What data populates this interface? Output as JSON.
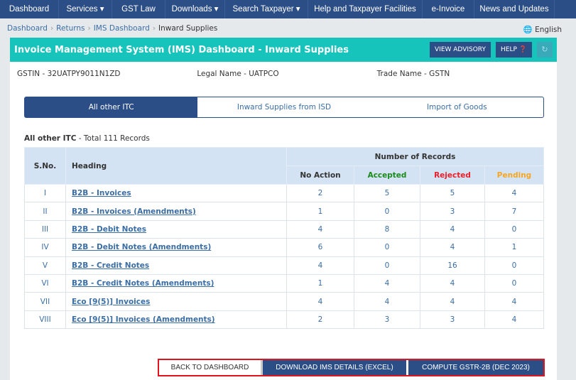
{
  "nav": [
    "Dashboard",
    "Services ▾",
    "GST Law",
    "Downloads ▾",
    "Search Taxpayer ▾",
    "Help and Taxpayer Facilities",
    "e-Invoice",
    "News and Updates"
  ],
  "breadcrumb": [
    "Dashboard",
    "Returns",
    "IMS Dashboard",
    "Inward Supplies"
  ],
  "language": "English",
  "header": {
    "title": "Invoice Management System (IMS) Dashboard - Inward Supplies",
    "advisory": "VIEW ADVISORY",
    "help": "HELP"
  },
  "info": {
    "gstin": "GSTIN - 32UATPY9011N1ZD",
    "legal": "Legal Name - UATPCO",
    "trade": "Trade Name - GSTN"
  },
  "tabs": [
    "All other ITC",
    "Inward Supplies from ISD",
    "Import of Goods"
  ],
  "section": {
    "title": "All other ITC",
    "total": " - Total 111 Records"
  },
  "table": {
    "headers": {
      "sno": "S.No.",
      "heading": "Heading",
      "group": "Number of Records",
      "no_action": "No Action",
      "accepted": "Accepted",
      "rejected": "Rejected",
      "pending": "Pending"
    },
    "colors": {
      "accepted": "#1a8a1a",
      "rejected": "#e8202a",
      "pending": "#f5a623"
    },
    "rows": [
      [
        "I",
        "B2B - Invoices",
        "2",
        "5",
        "5",
        "4"
      ],
      [
        "II",
        "B2B - Invoices (Amendments)",
        "1",
        "0",
        "3",
        "7"
      ],
      [
        "III",
        "B2B - Debit Notes",
        "4",
        "8",
        "4",
        "0"
      ],
      [
        "IV",
        "B2B - Debit Notes (Amendments)",
        "6",
        "0",
        "4",
        "1"
      ],
      [
        "V",
        "B2B - Credit Notes",
        "4",
        "0",
        "16",
        "0"
      ],
      [
        "VI",
        "B2B - Credit Notes (Amendments)",
        "1",
        "4",
        "4",
        "0"
      ],
      [
        "VII",
        "Eco [9(5)] Invoices",
        "4",
        "4",
        "4",
        "4"
      ],
      [
        "VIII",
        "Eco [9(5)] Invoices (Amendments)",
        "2",
        "3",
        "3",
        "4"
      ]
    ]
  },
  "buttons": {
    "back": "BACK TO DASHBOARD",
    "download": "DOWNLOAD IMS DETAILS (EXCEL)",
    "compute": "COMPUTE GSTR-2B (DEC 2023)"
  }
}
